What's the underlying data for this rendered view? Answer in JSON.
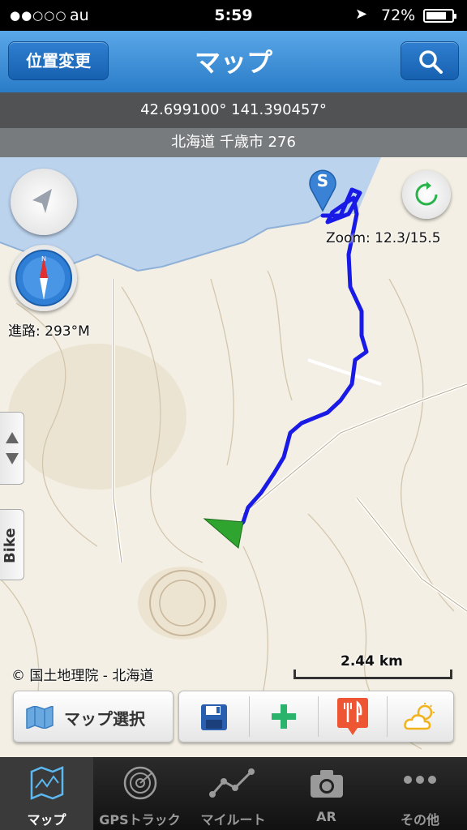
{
  "status_bar": {
    "signal": "●●○○○",
    "carrier": "au",
    "time": "5:59",
    "battery": "72%"
  },
  "nav": {
    "left_button": "位置変更",
    "title": "マップ",
    "search_icon": "search-icon"
  },
  "coordinates": "42.699100° 141.390457°",
  "address": "北海道 千歳市 276",
  "map": {
    "zoom": "Zoom: 12.3/15.5",
    "heading": "進路: 293°M",
    "copyright": "© 国土地理院 - 北海道",
    "scale": "2.44 km",
    "start_marker": "S",
    "side_tab_label": "Bike",
    "colors": {
      "track": "#1a1ae6",
      "water": "#bcd3ee",
      "land": "#f3efe4",
      "current": "#2fa52f"
    }
  },
  "toolbar": {
    "map_select": "マップ選択",
    "icons": [
      "map-icon",
      "save-icon",
      "add-icon",
      "restaurant-icon",
      "weather-icon"
    ]
  },
  "tabs": [
    {
      "label": "マップ",
      "icon": "map-icon",
      "active": true
    },
    {
      "label": "GPSトラック",
      "icon": "radar-icon",
      "active": false
    },
    {
      "label": "マイルート",
      "icon": "route-icon",
      "active": false
    },
    {
      "label": "AR",
      "icon": "camera-icon",
      "active": false
    },
    {
      "label": "その他",
      "icon": "more-icon",
      "active": false
    }
  ]
}
